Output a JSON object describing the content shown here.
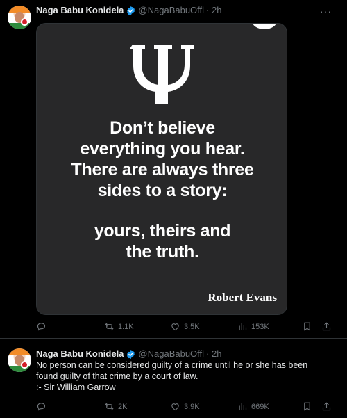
{
  "tweets": [
    {
      "author_name": "Naga Babu Konidela",
      "handle": "@NagaBabuOffl",
      "time": "· 2h",
      "more": "···",
      "image": {
        "symbol": "Ψ",
        "quote_lines": [
          "Don’t believe",
          "everything you hear.",
          "There are always three",
          "sides to a story:",
          "",
          "yours, theirs and",
          "the truth."
        ],
        "author": "Robert Evans"
      },
      "stats": {
        "replies": "",
        "retweets": "1.1K",
        "likes": "3.5K",
        "views": "153K"
      }
    },
    {
      "author_name": "Naga Babu Konidela",
      "handle": "@NagaBabuOffl",
      "time": "· 2h",
      "body_lines": [
        "No person can be considered guilty of a crime until he or she has been",
        "found guilty of that crime by a court of law.",
        ":- Sir William Garrow"
      ],
      "stats": {
        "retweets": "2K",
        "likes": "3.9K",
        "views": "669K"
      }
    }
  ],
  "colors": {
    "background": "#000000",
    "muted": "#71767b",
    "text": "#e7e9ea",
    "verified": "#1d9bf0",
    "image_bg": "#282829"
  },
  "icons": [
    "reply-icon",
    "retweet-icon",
    "like-icon",
    "views-icon",
    "bookmark-icon",
    "share-icon",
    "verified-badge-icon",
    "more-icon"
  ]
}
